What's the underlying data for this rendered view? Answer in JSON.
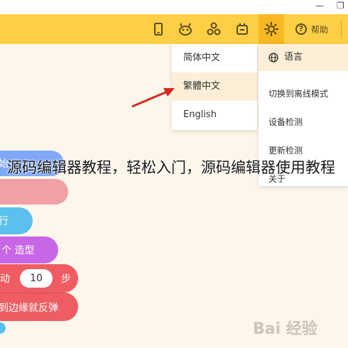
{
  "window": {
    "minimize_glyph": "—",
    "restore_glyph": "❐"
  },
  "toolbar": {
    "icons": [
      "tablet-icon",
      "robot-icon",
      "extensions-icon",
      "device-icon",
      "settings-icon"
    ],
    "help_label": "帮助",
    "accent": "#fccf44",
    "active": "#f7b824"
  },
  "language_menu": {
    "items": [
      "简体中文",
      "繁體中文",
      "English"
    ],
    "highlighted_index": 1
  },
  "settings_menu": {
    "language_label": "语言",
    "items": [
      "切换到离线模式",
      "设备检测",
      "更新检测",
      "关于"
    ]
  },
  "overlay": {
    "title": "源码编辑器教程，轻松入门，源码编辑器使用教程"
  },
  "blocks": [
    {
      "text": "始",
      "color": "#7fa8f7"
    },
    {
      "text": "",
      "color": "#f1a0a8"
    },
    {
      "text": "行",
      "color": "#5bc0f0"
    },
    {
      "text": "个 造型",
      "color": "#c867e6"
    },
    {
      "prefix": "动",
      "value": "10",
      "suffix": "步",
      "color": "#ef5d62"
    },
    {
      "text": "到边缘就反弹",
      "color": "#ef5d62"
    }
  ],
  "watermark": {
    "text": "Bai 经验"
  }
}
